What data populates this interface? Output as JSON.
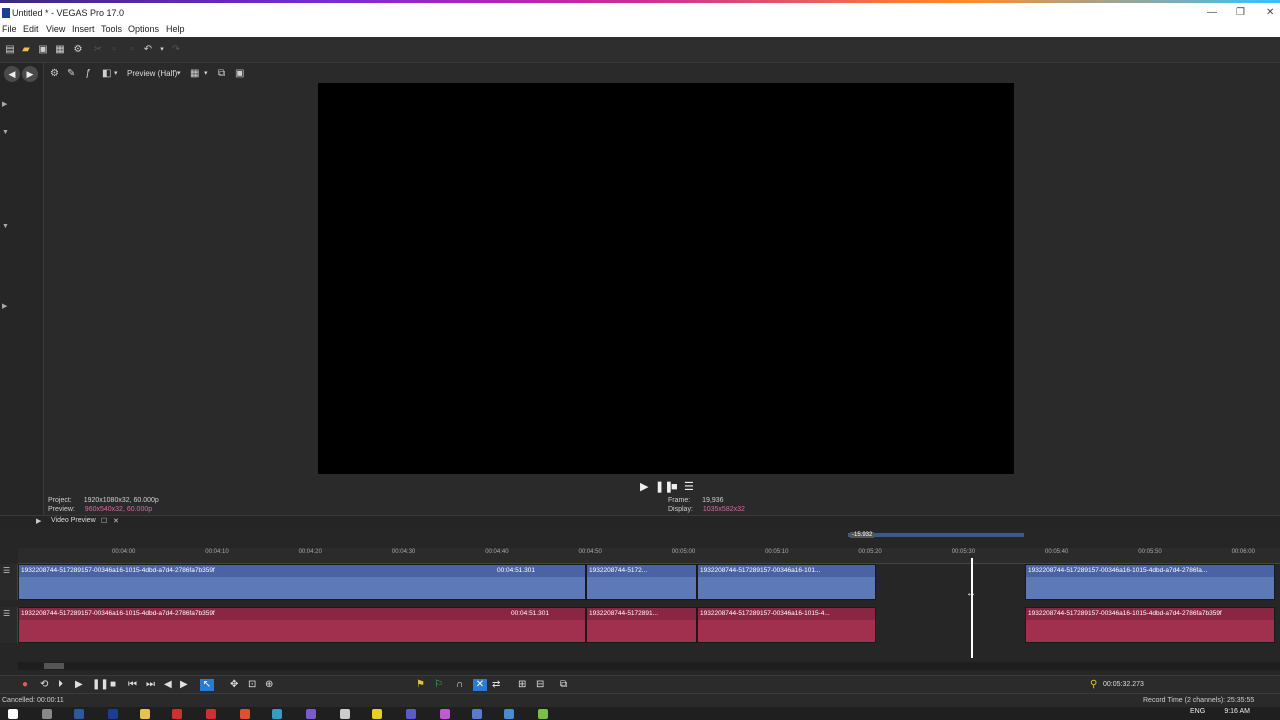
{
  "window": {
    "title": "Untitled * - VEGAS Pro 17.0",
    "controls": [
      "—",
      "❐",
      "✕"
    ]
  },
  "menu": {
    "items": [
      "File",
      "Edit",
      "View",
      "Insert",
      "Tools",
      "Options",
      "Help"
    ]
  },
  "preview": {
    "quality_label": "Preview (Half)",
    "project_label": "Project:",
    "project_value": "1920x1080x32, 60.000p",
    "preview_label": "Preview:",
    "preview_value": "960x540x32, 60.000p",
    "frame_label": "Frame:",
    "frame_value": "19,936",
    "display_label": "Display:",
    "display_value": "1035x582x32",
    "tab_label": "Video Preview"
  },
  "timeline": {
    "ruler_ticks": [
      "00:04:00",
      "00:04:10",
      "00:04:20",
      "00:04:30",
      "00:04:40",
      "00:04:50",
      "00:05:00",
      "00:05:10",
      "00:05:20",
      "00:05:30",
      "00:05:40",
      "00:05:50",
      "00:06:00"
    ],
    "selection_label": "-15.932",
    "clip_name_long": "19322087​44-517289157-00346a16-1015-4dbd-a7d4-2786fa7b359f",
    "clip_name_short1": "19322087​44-5172...",
    "clip_name_mid": "19322087​44-517289157-00346a16-101...",
    "clip_name_right": "19322087​44-517289157-00346a16-1015-4dbd-a7d4-2786fa...",
    "audio_name_short": "19322087​44-5172891...",
    "audio_name_mid": "19322087​44-517289157-00346a16-1015-4...",
    "clip_timecode": "00:04:51.301",
    "cursor_time": "00:05:32.273"
  },
  "status": {
    "left": "Cancelled: 00:00:11",
    "right": "Record Time (2 channels): 25:35:55"
  },
  "taskbar": {
    "time": "9:16 AM",
    "lang": "ENG"
  },
  "colors": {
    "video_clip": "#5e79b8",
    "audio_clip": "#a0304e"
  }
}
